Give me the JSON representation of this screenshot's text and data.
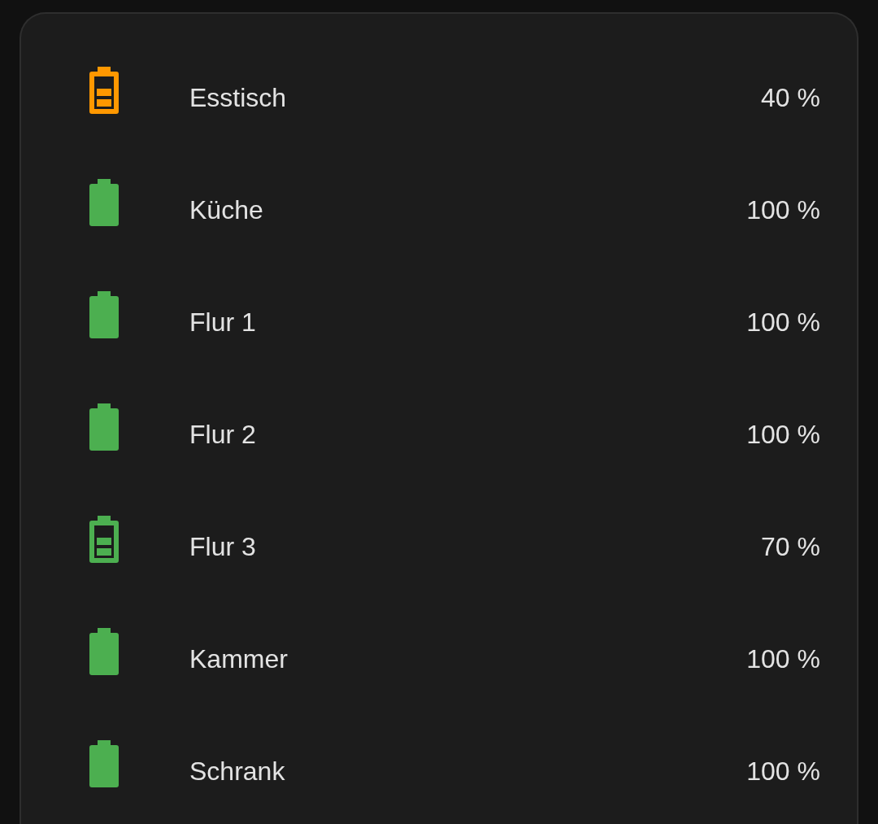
{
  "rows": [
    {
      "name": "Esstisch",
      "value": "40 %",
      "kind": "partial",
      "color": "#ff9800"
    },
    {
      "name": "Küche",
      "value": "100 %",
      "kind": "full",
      "color": "#4caf50"
    },
    {
      "name": "Flur 1",
      "value": "100 %",
      "kind": "full",
      "color": "#4caf50"
    },
    {
      "name": "Flur 2",
      "value": "100 %",
      "kind": "full",
      "color": "#4caf50"
    },
    {
      "name": "Flur 3",
      "value": "70 %",
      "kind": "partial",
      "color": "#4caf50"
    },
    {
      "name": "Kammer",
      "value": "100 %",
      "kind": "full",
      "color": "#4caf50"
    },
    {
      "name": "Schrank",
      "value": "100 %",
      "kind": "full",
      "color": "#4caf50"
    }
  ]
}
